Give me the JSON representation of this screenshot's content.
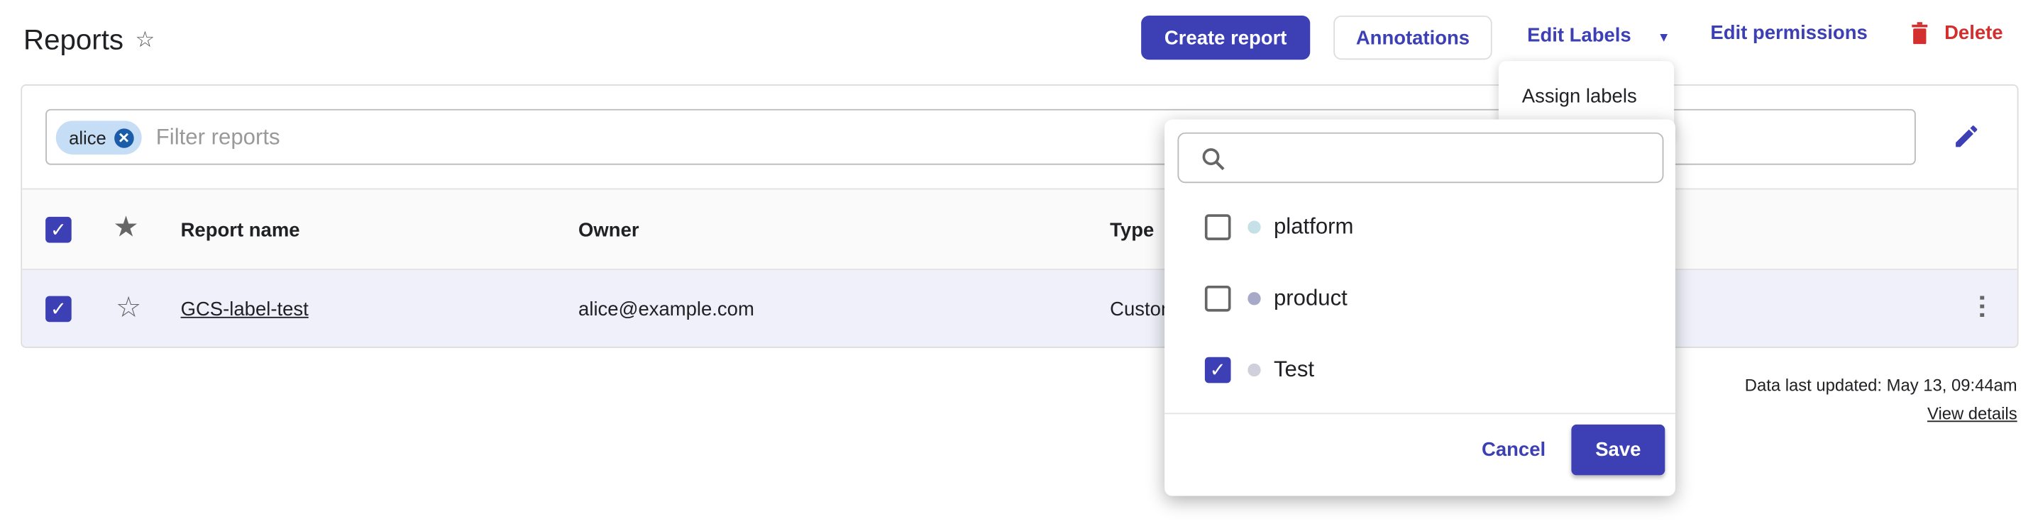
{
  "header": {
    "title": "Reports",
    "create_label": "Create report",
    "annotations_label": "Annotations",
    "edit_labels_label": "Edit Labels",
    "edit_permissions_label": "Edit permissions",
    "delete_label": "Delete"
  },
  "filter": {
    "chips": [
      {
        "label": "alice"
      }
    ],
    "placeholder": "Filter reports"
  },
  "table": {
    "columns": [
      "Report name",
      "Owner",
      "Type"
    ],
    "rows": [
      {
        "name": "GCS-label-test",
        "owner": "alice@example.com",
        "type": "Custom",
        "selected": true,
        "starred": false
      }
    ],
    "all_selected": true
  },
  "edit_labels_menu": {
    "items": [
      "Assign labels"
    ]
  },
  "labels_popup": {
    "search_value": "",
    "labels": [
      {
        "name": "platform",
        "checked": false,
        "color": "#c5e0e6"
      },
      {
        "name": "product",
        "checked": false,
        "color": "#a6a9c8"
      },
      {
        "name": "Test",
        "checked": true,
        "color": "#d0d0dc"
      }
    ],
    "cancel_label": "Cancel",
    "save_label": "Save"
  },
  "footer": {
    "updated": "Data last updated: May 13, 09:44am",
    "view_details": "View details"
  },
  "colors": {
    "accent": "#3c40b4",
    "danger": "#d32f2f"
  }
}
